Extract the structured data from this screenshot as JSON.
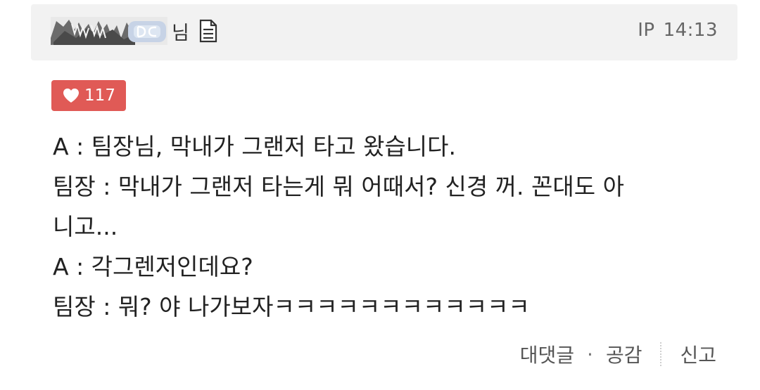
{
  "header": {
    "honorific": "님",
    "doc_icon": "document-icon",
    "ip_label": "IP",
    "time": "14:13"
  },
  "like": {
    "icon": "heart-icon",
    "count": "117"
  },
  "body": {
    "lines": [
      "A : 팀장님, 막내가 그랜저 타고 왔습니다.",
      "팀장 : 막내가 그랜저 타는게 뭐 어때서? 신경 꺼. 꼰대도 아",
      "니고...",
      "A : 각그렌저인데요?",
      "팀장 : 뭐? 야 나가보자ㅋㅋㅋㅋㅋㅋㅋㅋㅋㅋㅋㅋ"
    ]
  },
  "actions": {
    "reply": "대댓글",
    "separator_dot": "·",
    "empathy": "공감",
    "report": "신고"
  },
  "colors": {
    "header_bg": "#f2f2f2",
    "like_badge": "#e05a56",
    "text": "#222222",
    "muted": "#666666"
  }
}
